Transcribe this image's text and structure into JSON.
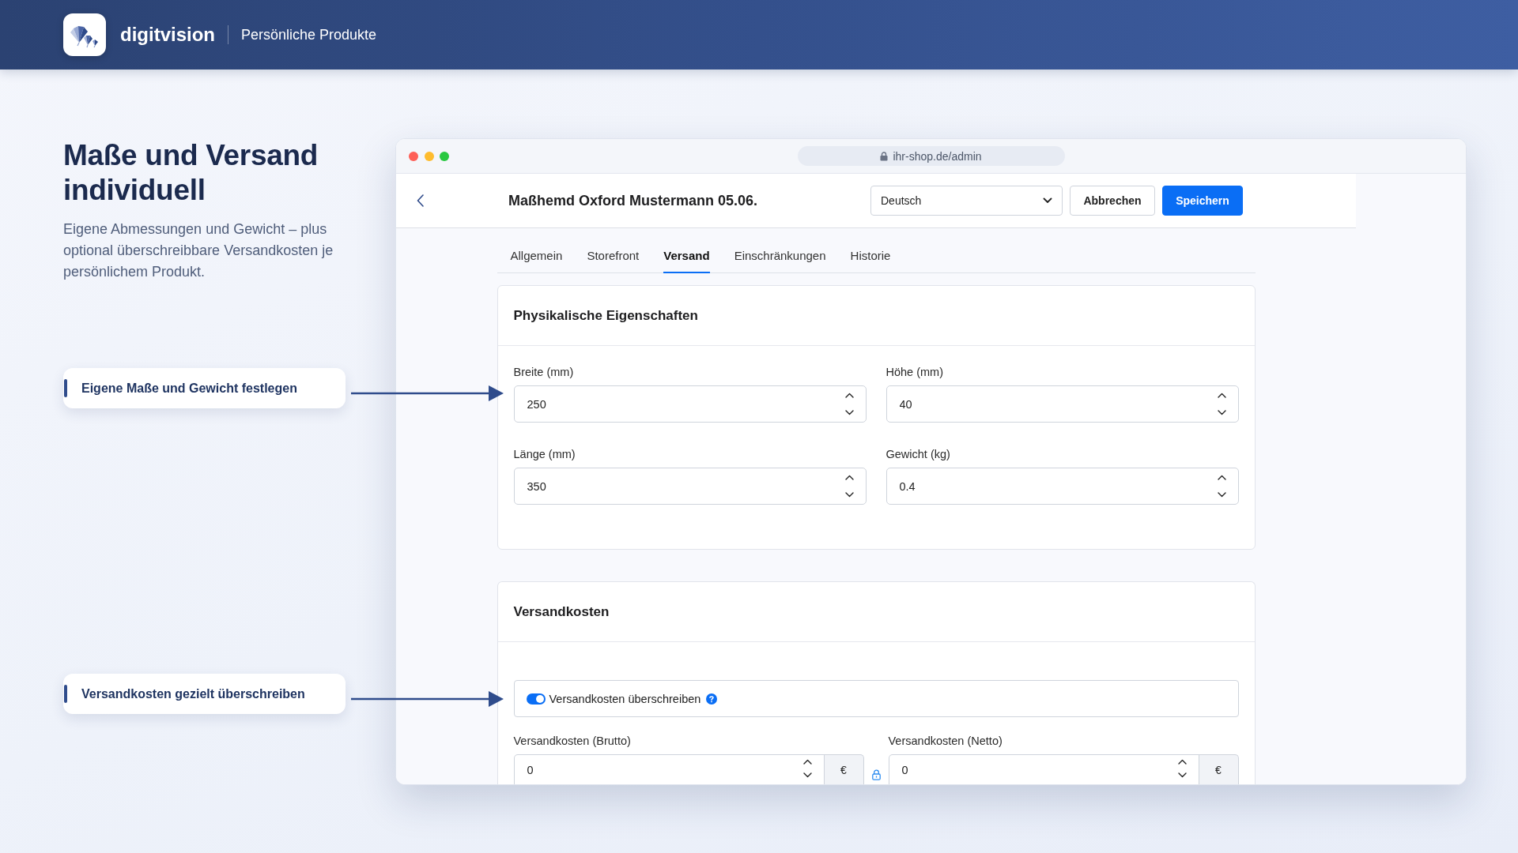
{
  "header": {
    "brand": "digitvision",
    "section": "Persönliche Produkte"
  },
  "intro": {
    "title": "Maße und Versand individuell",
    "text": "Eigene Abmessungen und Gewicht – plus optional überschreibbare Versandkosten je persönlichem Produkt."
  },
  "callouts": [
    {
      "text": "Eigene Maße und Gewicht festlegen"
    },
    {
      "text": "Versandkosten gezielt überschreiben"
    }
  ],
  "browser": {
    "url": "ihr-shop.de/admin"
  },
  "editor": {
    "title": "Maßhemd Oxford Mustermann 05.06.",
    "language": "Deutsch",
    "buttons": [
      {
        "label": "Abbrechen",
        "kind": "secondary"
      },
      {
        "label": "Speichern",
        "kind": "primary"
      }
    ]
  },
  "tabs": [
    {
      "label": "Allgemein",
      "selected": false
    },
    {
      "label": "Storefront",
      "selected": false
    },
    {
      "label": "Versand",
      "selected": true
    },
    {
      "label": "Einschränkungen",
      "selected": false
    },
    {
      "label": "Historie",
      "selected": false
    }
  ],
  "physical": {
    "title": "Physikalische Eigenschaften",
    "fields": [
      {
        "label": "Breite (mm)",
        "value": "250"
      },
      {
        "label": "Höhe (mm)",
        "value": "40"
      },
      {
        "label": "Länge (mm)",
        "value": "350"
      },
      {
        "label": "Gewicht (kg)",
        "value": "0.4"
      }
    ]
  },
  "shipping": {
    "title": "Versandkosten",
    "override": {
      "label": "Versandkosten überschreiben",
      "on": true
    },
    "fields": [
      {
        "label": "Versandkosten (Brutto)",
        "value": "0",
        "unit": "€"
      },
      {
        "label": "Versandkosten (Netto)",
        "value": "0",
        "unit": "€"
      }
    ]
  }
}
